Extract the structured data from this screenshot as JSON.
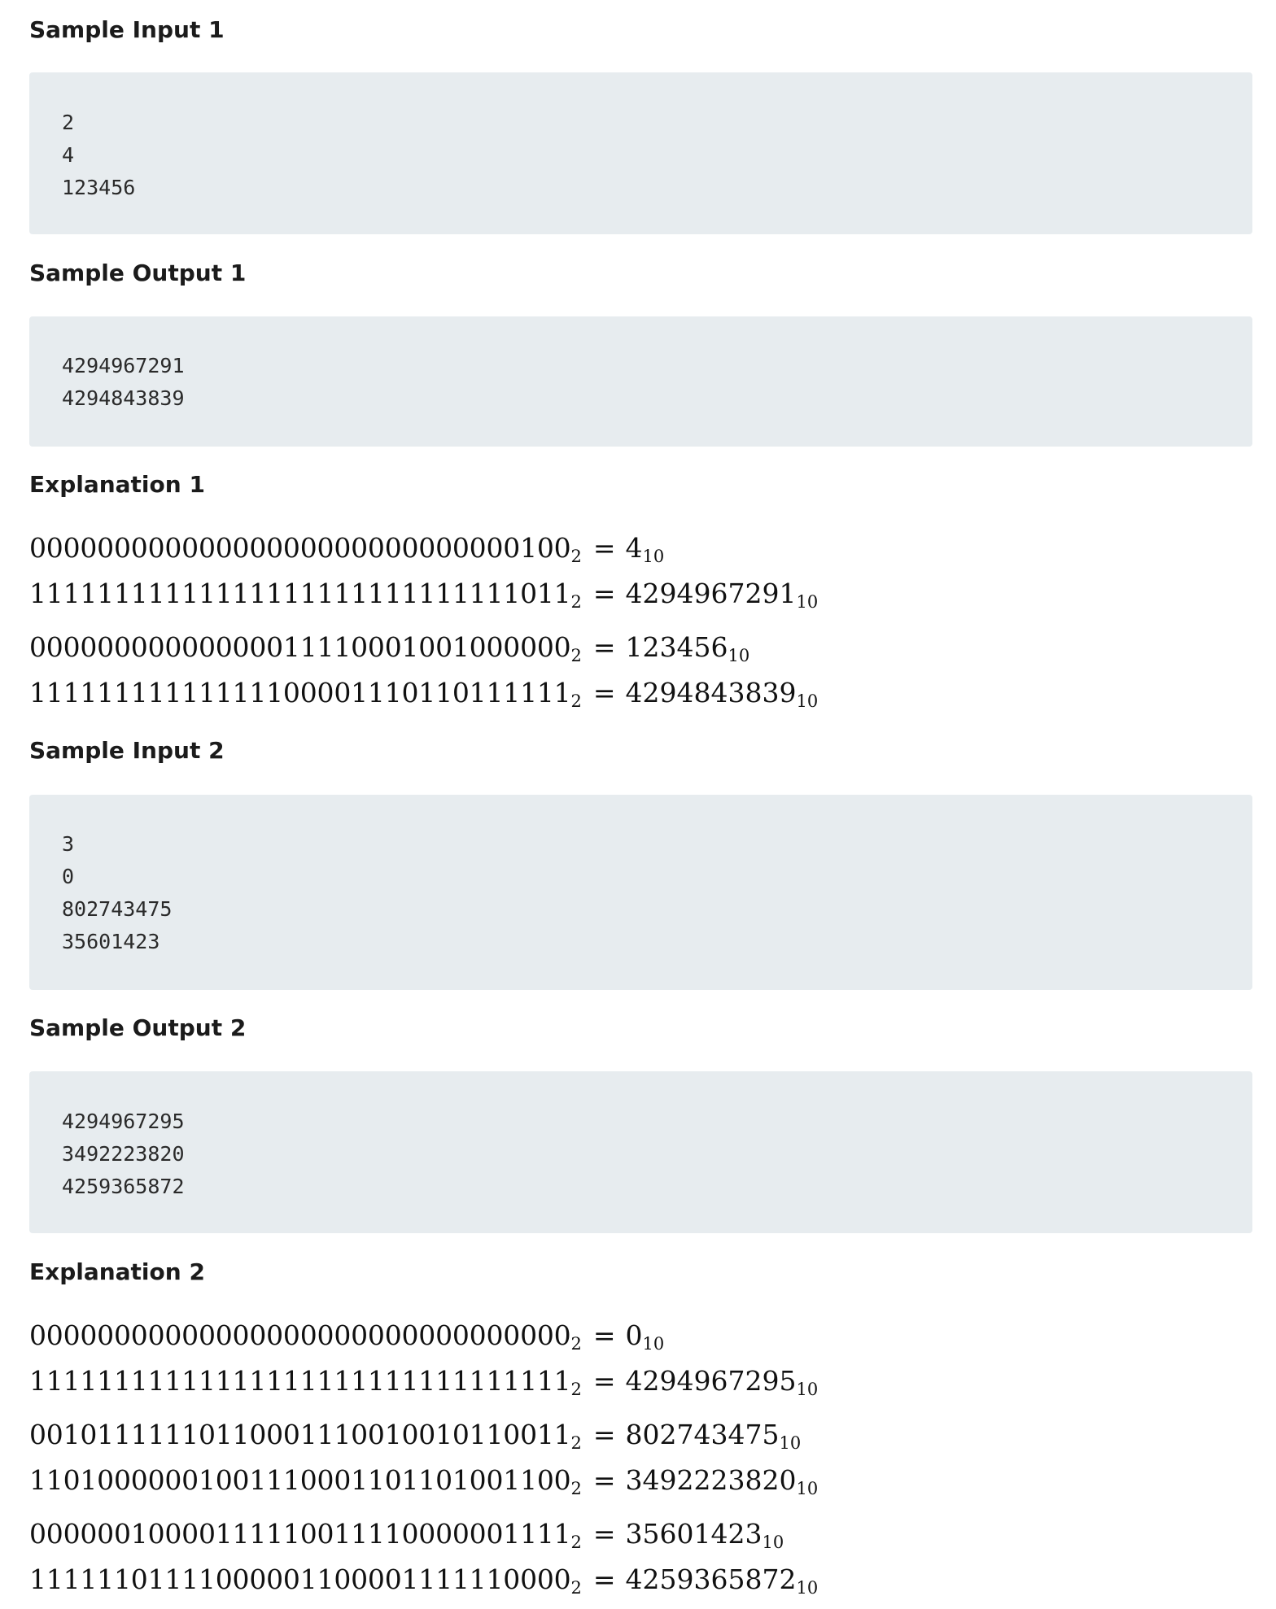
{
  "sections": {
    "sample_input_1": {
      "title": "Sample Input 1",
      "lines": [
        "2",
        "4",
        "123456"
      ]
    },
    "sample_output_1": {
      "title": "Sample Output 1",
      "lines": [
        "4294967291",
        "4294843839"
      ]
    },
    "explanation_1": {
      "title": "Explanation 1",
      "rows": [
        {
          "binary": "00000000000000000000000000000100",
          "binary_base": "2",
          "equals": "=",
          "decimal": "4",
          "decimal_base": "10"
        },
        {
          "binary": "11111111111111111111111111111011",
          "binary_base": "2",
          "equals": "=",
          "decimal": "4294967291",
          "decimal_base": "10"
        },
        {
          "binary": "00000000000000011110001001000000",
          "binary_base": "2",
          "equals": "=",
          "decimal": "123456",
          "decimal_base": "10"
        },
        {
          "binary": "11111111111111100001110110111111",
          "binary_base": "2",
          "equals": "=",
          "decimal": "4294843839",
          "decimal_base": "10"
        }
      ]
    },
    "sample_input_2": {
      "title": "Sample Input 2",
      "lines": [
        "3",
        "0",
        "802743475",
        "35601423"
      ]
    },
    "sample_output_2": {
      "title": "Sample Output 2",
      "lines": [
        "4294967295",
        "3492223820",
        "4259365872"
      ]
    },
    "explanation_2": {
      "title": "Explanation 2",
      "rows": [
        {
          "binary": "00000000000000000000000000000000",
          "binary_base": "2",
          "equals": "=",
          "decimal": "0",
          "decimal_base": "10"
        },
        {
          "binary": "11111111111111111111111111111111",
          "binary_base": "2",
          "equals": "=",
          "decimal": "4294967295",
          "decimal_base": "10"
        },
        {
          "binary": "00101111110110001110010010110011",
          "binary_base": "2",
          "equals": "=",
          "decimal": "802743475",
          "decimal_base": "10"
        },
        {
          "binary": "11010000001001110001101101001100",
          "binary_base": "2",
          "equals": "=",
          "decimal": "3492223820",
          "decimal_base": "10"
        },
        {
          "binary": "00000010000111110011110000001111",
          "binary_base": "2",
          "equals": "=",
          "decimal": "35601423",
          "decimal_base": "10"
        },
        {
          "binary": "11111101111000001100001111110000",
          "binary_base": "2",
          "equals": "=",
          "decimal": "4259365872",
          "decimal_base": "10"
        }
      ]
    }
  }
}
